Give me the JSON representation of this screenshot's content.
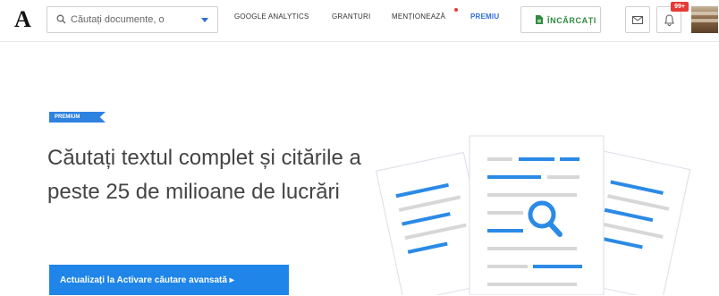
{
  "header": {
    "logo": "A",
    "search": {
      "placeholder": "Căutați documente, o",
      "icon": "search-icon"
    },
    "nav": [
      {
        "label": "GOOGLE ANALYTICS"
      },
      {
        "label": "GRANTURI"
      },
      {
        "label": "MENȚIONEAZĂ"
      },
      {
        "label": "PREMIU",
        "color": "#2f6fdb"
      }
    ],
    "upload_label": "ÎNCĂRCAȚI",
    "upload_color": "#2e8b3e",
    "icons": [
      "doc-icon",
      "mail-icon",
      "bell-icon"
    ],
    "notification_badge": "99+"
  },
  "hero": {
    "tag": "PREMIUM",
    "headline": "Căutați textul complet și citările a peste 25 de milioane de lucrări",
    "cta": "Actualizați la Activare căutare avansată ▸",
    "accent_color": "#1f85e8"
  }
}
